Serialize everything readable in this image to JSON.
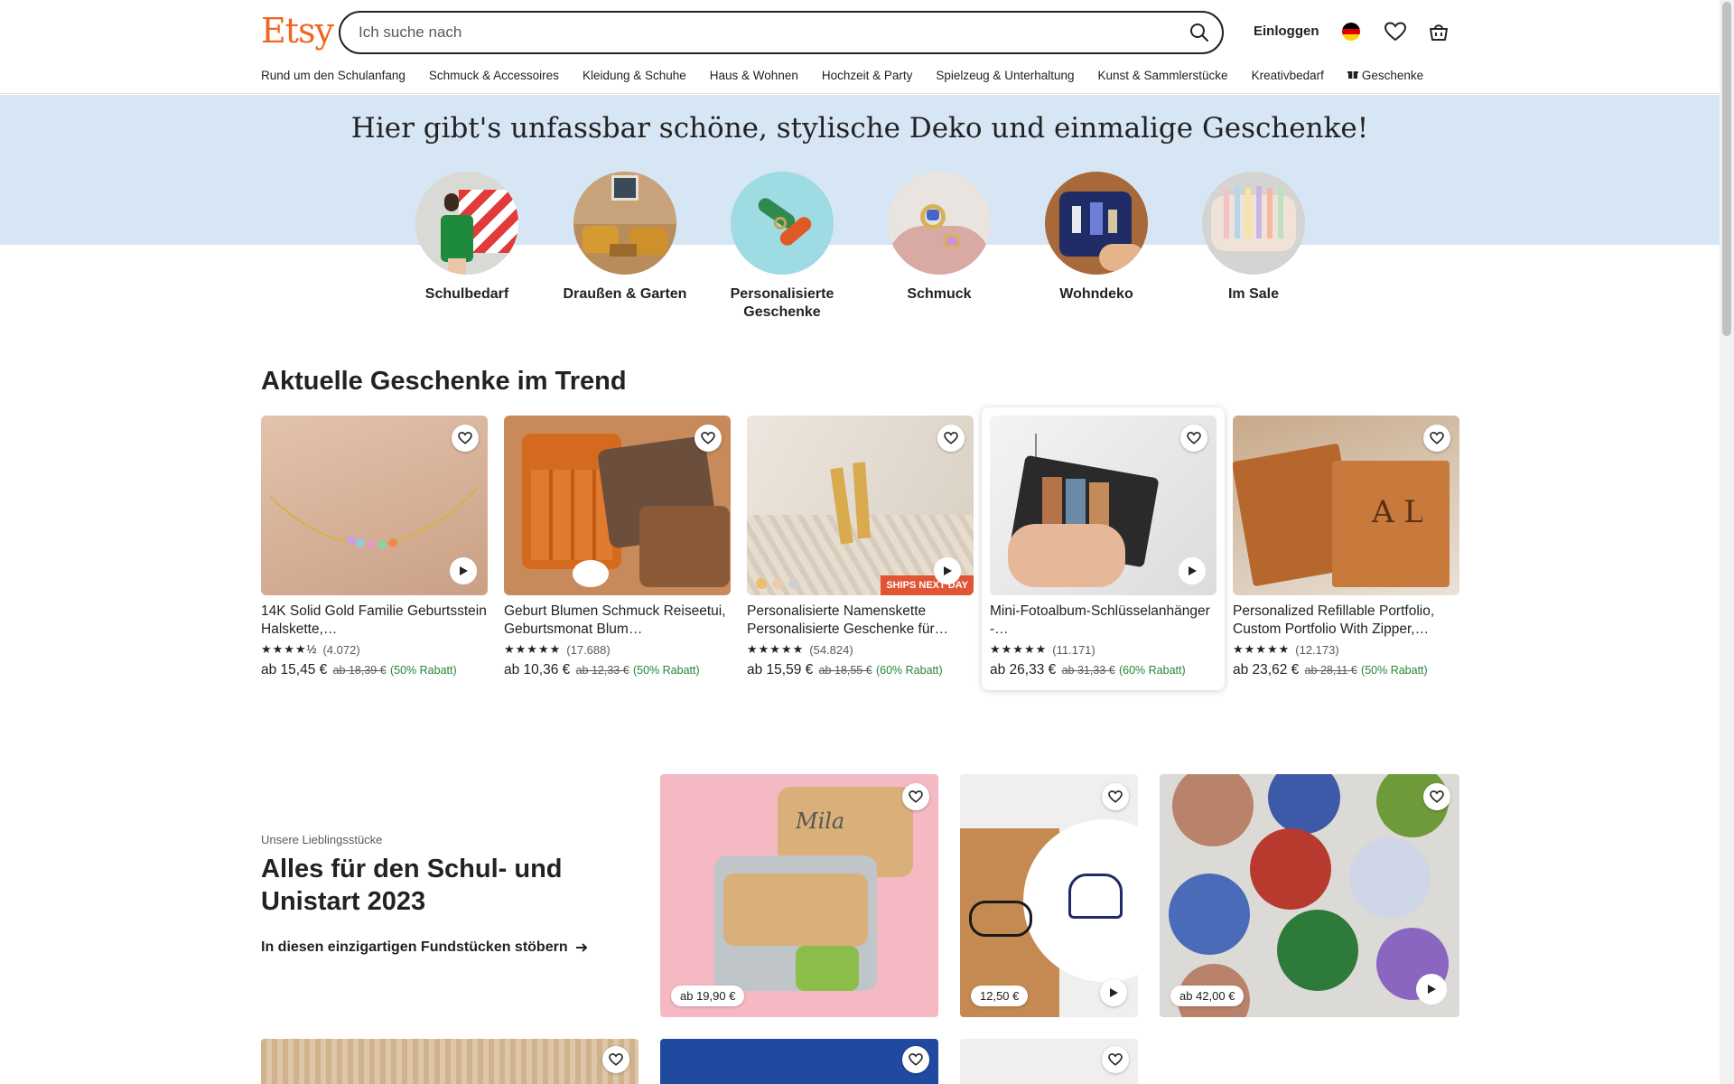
{
  "brand": {
    "logo": "Etsy",
    "accent": "#f1641e"
  },
  "search": {
    "placeholder": "Ich suche nach"
  },
  "header": {
    "login": "Einloggen"
  },
  "nav": [
    "Rund um den Schulanfang",
    "Schmuck & Accessoires",
    "Kleidung & Schuhe",
    "Haus & Wohnen",
    "Hochzeit & Party",
    "Spielzeug & Unterhaltung",
    "Kunst & Sammlerstücke",
    "Kreativbedarf",
    "Geschenke"
  ],
  "hero": {
    "title": "Hier gibt's unfassbar schöne, stylische Deko und einmalige Geschenke!",
    "categories": [
      {
        "label": "Schulbedarf"
      },
      {
        "label": "Draußen & Garten"
      },
      {
        "label": "Personalisierte Geschenke"
      },
      {
        "label": "Schmuck"
      },
      {
        "label": "Wohndeko"
      },
      {
        "label": "Im Sale"
      }
    ]
  },
  "trending": {
    "title": "Aktuelle Geschenke im Trend",
    "items": [
      {
        "title": "14K Solid Gold Familie Geburtsstein Halskette,…",
        "stars": 4.5,
        "reviews": "(4.072)",
        "price": "ab 15,45 €",
        "old_price": "ab 18,39 €",
        "discount": "(50% Rabatt)"
      },
      {
        "title": "Geburt Blumen Schmuck Reiseetui, Geburtsmonat Blum…",
        "stars": 5,
        "reviews": "(17.688)",
        "price": "ab 10,36 €",
        "old_price": "ab 12,33 €",
        "discount": "(50% Rabatt)"
      },
      {
        "title": "Personalisierte Namenskette Personalisierte Geschenke für…",
        "stars": 5,
        "reviews": "(54.824)",
        "price": "ab 15,59 €",
        "old_price": "ab 18,55 €",
        "discount": "(60% Rabatt)",
        "badge": "SHIPS NEXT DAY"
      },
      {
        "title": "Mini-Fotoalbum-Schlüsselanhänger -…",
        "stars": 5,
        "reviews": "(11.171)",
        "price": "ab 26,33 €",
        "old_price": "ab 31,33 €",
        "discount": "(60% Rabatt)"
      },
      {
        "title": "Personalized Refillable Portfolio, Custom Portfolio With Zipper,…",
        "stars": 5,
        "reviews": "(12.173)",
        "price": "ab 23,62 €",
        "old_price": "ab 28,11 €",
        "discount": "(50% Rabatt)"
      }
    ]
  },
  "favorites": {
    "subtitle": "Unsere Lieblingsstücke",
    "title": "Alles für den Schul- und Unistart 2023",
    "link": "In diesen einzigartigen Fundstücken stöbern",
    "tiles": [
      {
        "price": "ab 19,90 €"
      },
      {
        "price": "12,50 €"
      },
      {
        "price": "ab 42,00 €"
      }
    ]
  }
}
